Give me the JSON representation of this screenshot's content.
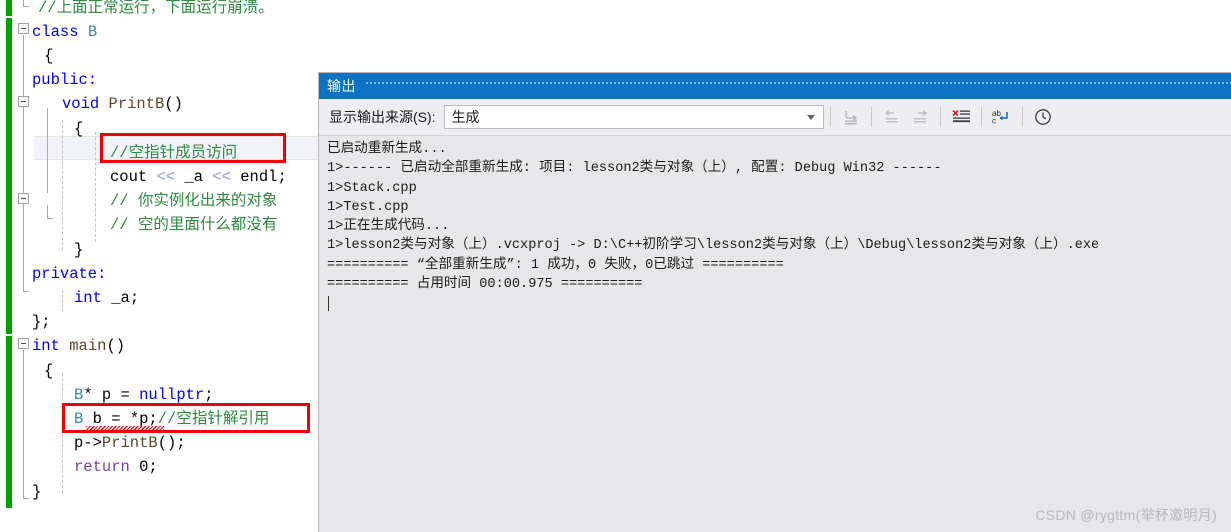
{
  "editor": {
    "lines": [
      {
        "indent": 38,
        "segments": [
          {
            "t": "//上面正常运行，下面运行崩溃。",
            "c": "cmt"
          }
        ]
      },
      {
        "indent": 32,
        "segments": [
          {
            "t": "class ",
            "c": "kw"
          },
          {
            "t": "B",
            "c": "type"
          }
        ]
      },
      {
        "indent": 44,
        "segments": [
          {
            "t": "{",
            "c": "plain"
          }
        ]
      },
      {
        "indent": 32,
        "segments": [
          {
            "t": "public:",
            "c": "kw"
          }
        ]
      },
      {
        "indent": 62,
        "segments": [
          {
            "t": "void ",
            "c": "kw"
          },
          {
            "t": "PrintB",
            "c": "fn"
          },
          {
            "t": "()",
            "c": "plain"
          }
        ]
      },
      {
        "indent": 74,
        "segments": [
          {
            "t": "{",
            "c": "plain"
          }
        ]
      },
      {
        "indent": 110,
        "segments": [
          {
            "t": "//空指针成员访问",
            "c": "cmt"
          }
        ]
      },
      {
        "indent": 110,
        "segments": [
          {
            "t": "cout ",
            "c": "plain"
          },
          {
            "t": "<< ",
            "c": "op"
          },
          {
            "t": "_a ",
            "c": "plain"
          },
          {
            "t": "<< ",
            "c": "op"
          },
          {
            "t": "endl;",
            "c": "plain"
          }
        ]
      },
      {
        "indent": 110,
        "segments": [
          {
            "t": "// 你实例化出来的对象",
            "c": "cmt"
          }
        ]
      },
      {
        "indent": 110,
        "segments": [
          {
            "t": "// 空的里面什么都没有",
            "c": "cmt"
          }
        ]
      },
      {
        "indent": 74,
        "segments": [
          {
            "t": "}",
            "c": "plain"
          }
        ]
      },
      {
        "indent": 32,
        "segments": [
          {
            "t": "private:",
            "c": "kw"
          }
        ]
      },
      {
        "indent": 74,
        "segments": [
          {
            "t": "int ",
            "c": "kw"
          },
          {
            "t": "_a;",
            "c": "plain"
          }
        ]
      },
      {
        "indent": 32,
        "segments": [
          {
            "t": "};",
            "c": "plain"
          }
        ]
      },
      {
        "indent": 32,
        "segments": [
          {
            "t": "int ",
            "c": "kw"
          },
          {
            "t": "main",
            "c": "fn"
          },
          {
            "t": "()",
            "c": "plain"
          }
        ]
      },
      {
        "indent": 44,
        "segments": [
          {
            "t": "{",
            "c": "plain"
          }
        ]
      },
      {
        "indent": 74,
        "segments": [
          {
            "t": "B",
            "c": "type"
          },
          {
            "t": "* p = ",
            "c": "plain"
          },
          {
            "t": "nullptr",
            "c": "kw"
          },
          {
            "t": ";",
            "c": "plain"
          }
        ]
      },
      {
        "indent": 74,
        "segments": [
          {
            "t": "B",
            "c": "type"
          },
          {
            "t": " b = *p;",
            "c": "plain"
          },
          {
            "t": "//空指针解引用",
            "c": "cmt"
          }
        ]
      },
      {
        "indent": 74,
        "segments": [
          {
            "t": "p->",
            "c": "plain"
          },
          {
            "t": "PrintB",
            "c": "fn"
          },
          {
            "t": "();",
            "c": "plain"
          }
        ]
      },
      {
        "indent": 74,
        "segments": [
          {
            "t": "return ",
            "c": "purple"
          },
          {
            "t": "0;",
            "c": "plain"
          }
        ]
      },
      {
        "indent": 32,
        "segments": [
          {
            "t": "}",
            "c": "plain"
          }
        ]
      }
    ],
    "annotation_color": "#f40000",
    "comment_color": "#2e8b3d",
    "keyword_color": "#0000ff",
    "type_color": "#2b91af",
    "changebar_color": "#00a000"
  },
  "output_window": {
    "title": "输出",
    "source_label": "显示输出来源(S):",
    "source_value": "生成",
    "titlebar_color": "#0a74c4",
    "toolbar_buttons": [
      {
        "name": "go-to-message-icon",
        "label": "转到消息"
      },
      {
        "name": "previous-message-icon",
        "label": "上一条"
      },
      {
        "name": "next-message-icon",
        "label": "下一条"
      },
      {
        "name": "clear-all-icon",
        "label": "全部清除"
      },
      {
        "name": "toggle-word-wrap-icon",
        "label": "自动换行"
      },
      {
        "name": "show-timestamps-icon",
        "label": "显示时间戳"
      }
    ],
    "body_lines": [
      "已启动重新生成...",
      "1>------ 已启动全部重新生成: 项目: lesson2类与对象（上）, 配置: Debug Win32 ------",
      "1>Stack.cpp",
      "1>Test.cpp",
      "1>正在生成代码...",
      "1>lesson2类与对象（上）.vcxproj -> D:\\C++初阶学习\\lesson2类与对象（上）\\Debug\\lesson2类与对象（上）.exe",
      "========== “全部重新生成”: 1 成功，0 失败，0已跳过 ==========",
      "========== 占用时间 00:00.975 =========="
    ]
  },
  "watermark": "CSDN @rygttm(举杯邀明月)"
}
